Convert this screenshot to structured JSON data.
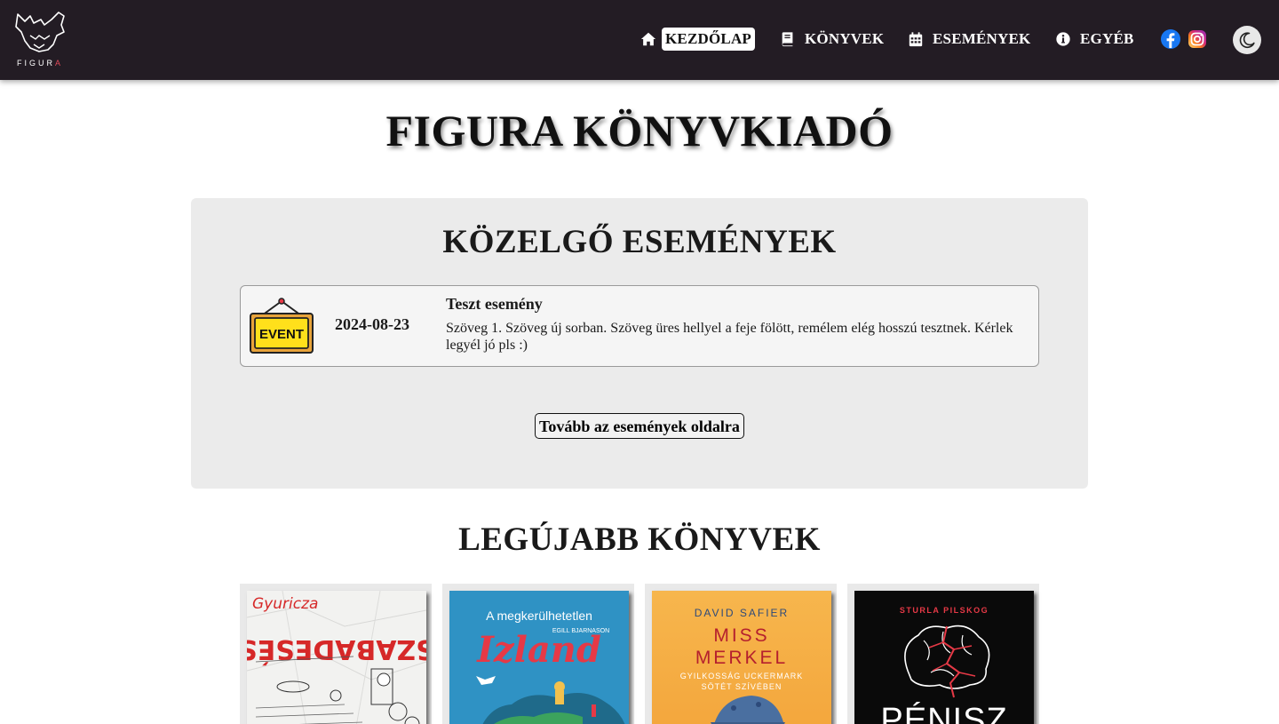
{
  "header": {
    "logo_text": "FIGUR",
    "logo_text_accent": "A",
    "nav": [
      {
        "label": "KEZDŐLAP",
        "icon": "home-icon",
        "active": true
      },
      {
        "label": "KÖNYVEK",
        "icon": "book-icon",
        "active": false
      },
      {
        "label": "ESEMÉNYEK",
        "icon": "calendar-icon",
        "active": false
      },
      {
        "label": "EGYÉB",
        "icon": "info-icon",
        "active": false
      }
    ],
    "social": [
      {
        "icon": "facebook-icon",
        "color": "#1877f2"
      },
      {
        "icon": "instagram-icon",
        "color": "#e1306c"
      }
    ],
    "theme_toggle_icon": "moon-icon",
    "background": "#231c24"
  },
  "main": {
    "title": "FIGURA KÖNYVKIADÓ",
    "events": {
      "heading": "KÖZELGŐ ESEMÉNYEK",
      "items": [
        {
          "icon_label": "EVENT",
          "date": "2024-08-23",
          "title": "Teszt esemény",
          "description": "Szöveg 1. Szöveg új sorban. Szöveg üres hellyel a feje fölött, remélem elég hosszú tesztnek. Kérlek legyél jó pls :)"
        }
      ],
      "more_button": "Tovább az események oldalra"
    },
    "books": {
      "heading": "LEGÚJABB KÖNYVEK",
      "items": [
        {
          "author": "Gyuricza",
          "title": "SZABADESÉS"
        },
        {
          "pre_title": "A megkerülhetetlen",
          "author": "EGILL BJARNASON",
          "title": "Izland"
        },
        {
          "author": "DAVID SAFIER",
          "title_line1": "MISS",
          "title_line2": "MERKEL",
          "subtitle_line1": "GYILKOSSÁG UCKERMARK",
          "subtitle_line2": "SÖTÉT SZÍVÉBEN"
        },
        {
          "author": "STURLA PILSKOG",
          "title": "PÉNISZ"
        }
      ]
    }
  }
}
